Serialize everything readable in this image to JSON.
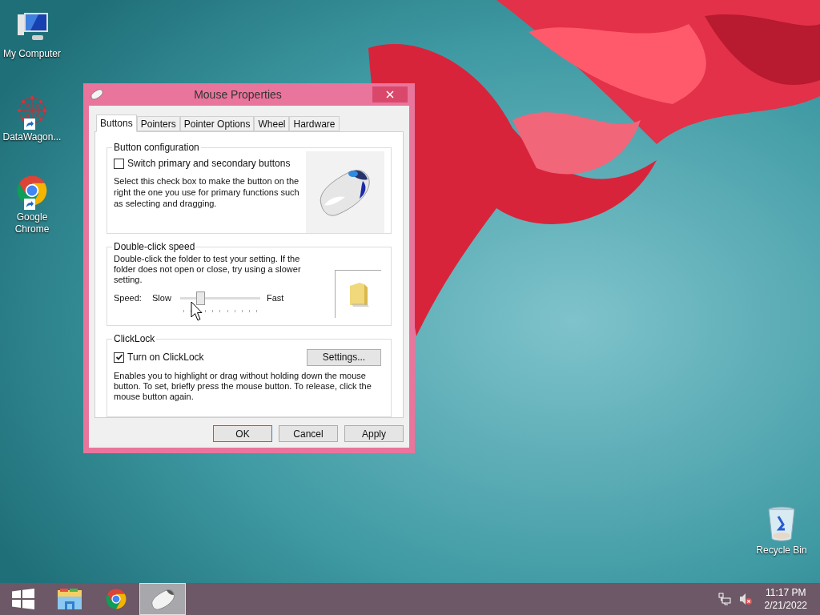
{
  "desktop_icons": [
    {
      "kind": "computer",
      "label": "My Computer",
      "shortcut": false
    },
    {
      "kind": "network",
      "label": "DataWagon...",
      "shortcut": true
    },
    {
      "kind": "chrome",
      "label": "Google Chrome",
      "shortcut": true
    },
    {
      "kind": "recycle",
      "label": "Recycle Bin",
      "shortcut": false
    }
  ],
  "window": {
    "title": "Mouse Properties",
    "tabs": [
      {
        "label": "Buttons",
        "selected": true
      },
      {
        "label": "Pointers",
        "selected": false
      },
      {
        "label": "Pointer Options",
        "selected": false
      },
      {
        "label": "Wheel",
        "selected": false
      },
      {
        "label": "Hardware",
        "selected": false
      }
    ],
    "button_configuration": {
      "title": "Button configuration",
      "checkbox": {
        "label": "Switch primary and secondary buttons",
        "checked": false
      },
      "description": "Select this check box to make the button on the right the one you use for primary functions such as selecting and dragging."
    },
    "double_click_speed": {
      "title": "Double-click speed",
      "description": "Double-click the folder to test your setting. If the folder does not open or close, try using a slower setting.",
      "speed_label": "Speed:",
      "slow_label": "Slow",
      "fast_label": "Fast",
      "slider": {
        "level": 0.22
      }
    },
    "clicklock": {
      "title": "ClickLock",
      "checkbox": {
        "label": "Turn on ClickLock",
        "checked": true
      },
      "settings_button": "Settings...",
      "description": "Enables you to highlight or drag without holding down the mouse button. To set, briefly press the mouse button. To release, click the mouse button again."
    },
    "buttons": [
      {
        "label": "OK",
        "default": true
      },
      {
        "label": "Cancel",
        "default": false
      },
      {
        "label": "Apply",
        "default": false
      }
    ]
  },
  "taskbar": {
    "items": [
      {
        "kind": "start",
        "selected": false
      },
      {
        "kind": "explorer",
        "selected": false
      },
      {
        "kind": "chrome",
        "selected": false
      },
      {
        "kind": "mouse",
        "selected": true
      }
    ],
    "tray": {
      "muted": true
    },
    "time": "11:17 PM",
    "date": "2/21/2022"
  }
}
